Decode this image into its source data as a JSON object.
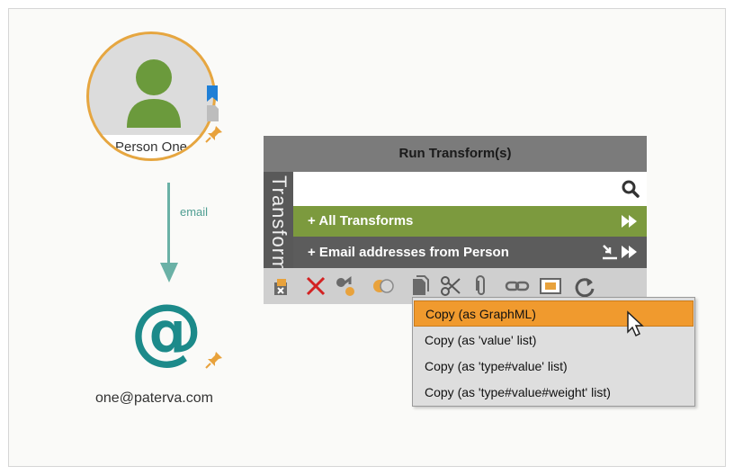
{
  "graph": {
    "person_node": {
      "label": "Person One",
      "icon": "person-icon"
    },
    "edge": {
      "label": "email"
    },
    "email_node": {
      "label": "one@paterva.com",
      "icon": "at-sign-icon"
    }
  },
  "run_transforms": {
    "title": "Run Transform(s)",
    "side_tab": "Transforms",
    "search_placeholder": "",
    "rows": [
      {
        "label": "+ All Transforms",
        "color": "#7c9a3e"
      },
      {
        "label": "+ Email addresses from Person",
        "color": "#5c5c5c"
      }
    ],
    "toolbar_icons": [
      "change-type-icon",
      "delete-icon",
      "merge-icon",
      "link-icon",
      "copy-icon",
      "cut-icon",
      "attach-icon",
      "chain-link-icon",
      "image-icon",
      "refresh-icon"
    ]
  },
  "context_menu": {
    "items": [
      {
        "label": "Copy (as GraphML)",
        "selected": true
      },
      {
        "label": "Copy (as 'value' list)",
        "selected": false
      },
      {
        "label": "Copy (as 'type#value' list)",
        "selected": false
      },
      {
        "label": "Copy (as 'type#value#weight' list)",
        "selected": false
      }
    ]
  },
  "colors": {
    "accent_orange": "#f09a2e",
    "node_ring": "#e6a640",
    "edge": "#6ab1a6",
    "green_row": "#7c9a3e"
  }
}
